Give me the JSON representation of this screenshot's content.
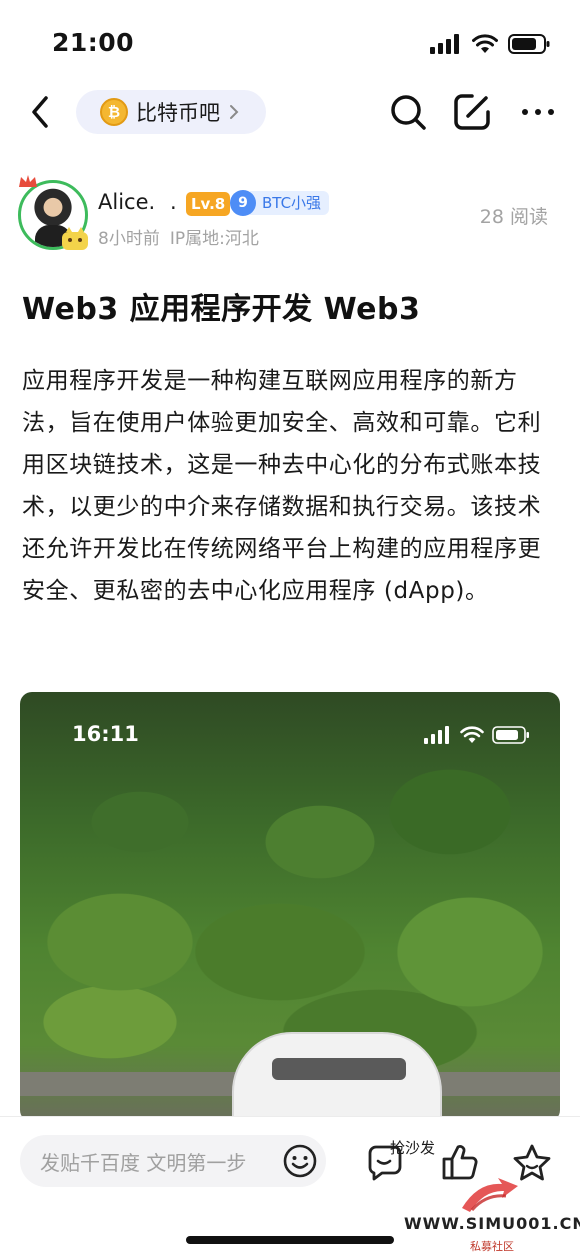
{
  "status_bar": {
    "time": "21:00"
  },
  "nav": {
    "forum_name": "比特币吧"
  },
  "author": {
    "name": "Alice.",
    "name_suffix": ".",
    "level_badge": "Lv.8",
    "fan_level": "9",
    "fan_name": "BTC小强",
    "time_ago": "8小时前",
    "ip_location": "IP属地:河北",
    "read_count": "28 阅读"
  },
  "post": {
    "title": "Web3 应用程序开发 Web3",
    "body": "应用程序开发是一种构建互联网应用程序的新方法，旨在使用户体验更加安全、高效和可靠。它利用区块链技术，这是一种去中心化的分布式账本技术，以更少的中介来存储数据和执行交易。该技术还允许开发比在传统网络平台上构建的应用程序更安全、更私密的去中心化应用程序 (dApp)。",
    "image": {
      "status_time": "16:11"
    }
  },
  "bottom_bar": {
    "reply_placeholder": "发贴千百度 文明第一步",
    "sofa_label": "抢沙发"
  },
  "watermark": {
    "url": "WWW.SIMU001.CN",
    "sub": "私募社区"
  },
  "colors": {
    "accent_green": "#3dbb5c",
    "level_orange": "#f6a623",
    "fan_blue": "#4e8df6"
  }
}
